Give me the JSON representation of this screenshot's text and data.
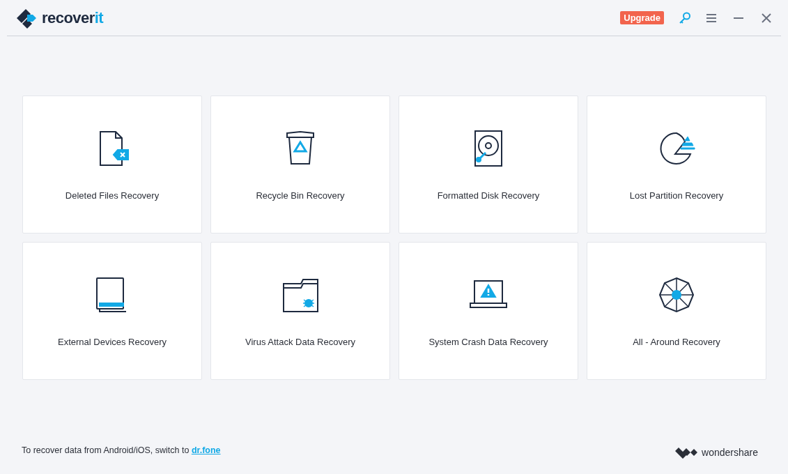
{
  "header": {
    "logo_text": "recover",
    "logo_accent": "it",
    "upgrade": "Upgrade"
  },
  "cards": [
    {
      "kind": "deleted",
      "label": "Deleted Files Recovery"
    },
    {
      "kind": "recycle",
      "label": "Recycle Bin Recovery"
    },
    {
      "kind": "disk",
      "label": "Formatted Disk Recovery"
    },
    {
      "kind": "partition",
      "label": "Lost Partition Recovery"
    },
    {
      "kind": "external",
      "label": "External Devices Recovery"
    },
    {
      "kind": "virus",
      "label": "Virus Attack Data Recovery"
    },
    {
      "kind": "crash",
      "label": "System Crash Data Recovery"
    },
    {
      "kind": "around",
      "label": "All - Around Recovery"
    }
  ],
  "footer": {
    "text": "To recover data from Android/iOS, switch to",
    "link": "dr.fone",
    "brand": "wondershare"
  }
}
